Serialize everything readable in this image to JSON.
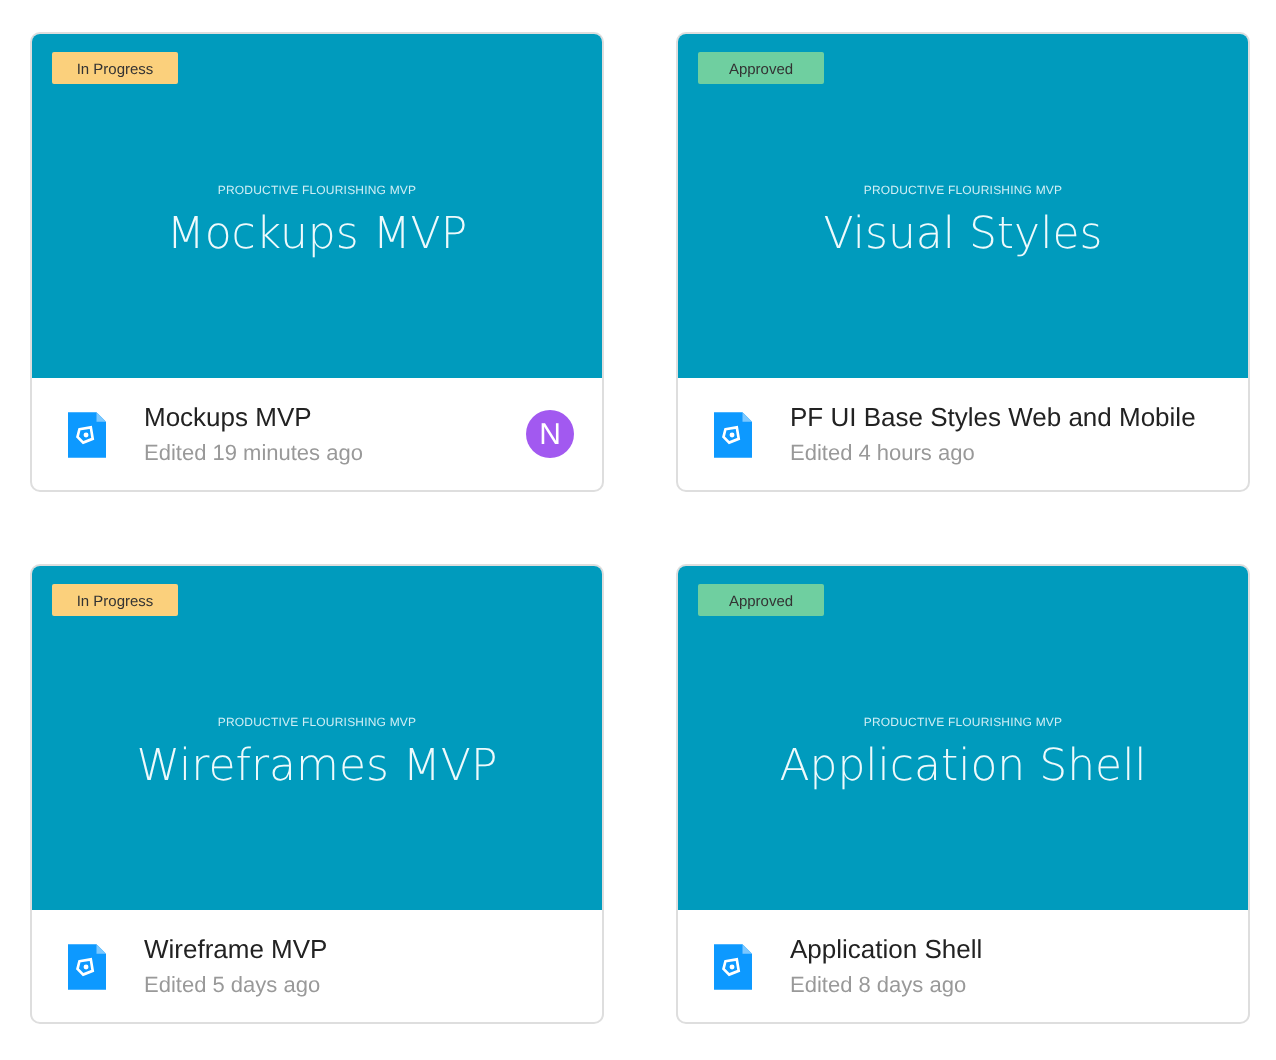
{
  "cards": [
    {
      "status": {
        "label": "In Progress",
        "color": "#fbd07c"
      },
      "thumbnail": {
        "kicker": "PRODUCTIVE FLOURISHING MVP",
        "title": "Mockups MVP"
      },
      "name": "Mockups MVP",
      "edited": "Edited 19 minutes ago",
      "avatar": {
        "initial": "N",
        "color": "#a259f0"
      }
    },
    {
      "status": {
        "label": "Approved",
        "color": "#6fcfa0"
      },
      "thumbnail": {
        "kicker": "PRODUCTIVE FLOURISHING MVP",
        "title": "Visual Styles"
      },
      "name": "PF UI Base Styles Web and Mobile",
      "edited": "Edited 4 hours ago"
    },
    {
      "status": {
        "label": "In Progress",
        "color": "#fbd07c"
      },
      "thumbnail": {
        "kicker": "PRODUCTIVE FLOURISHING MVP",
        "title": "Wireframes MVP"
      },
      "name": "Wireframe MVP",
      "edited": "Edited 5 days ago"
    },
    {
      "status": {
        "label": "Approved",
        "color": "#6fcfa0"
      },
      "thumbnail": {
        "kicker": "PRODUCTIVE FLOURISHING MVP",
        "title": "Application Shell"
      },
      "name": "Application Shell",
      "edited": "Edited 8 days ago"
    }
  ]
}
